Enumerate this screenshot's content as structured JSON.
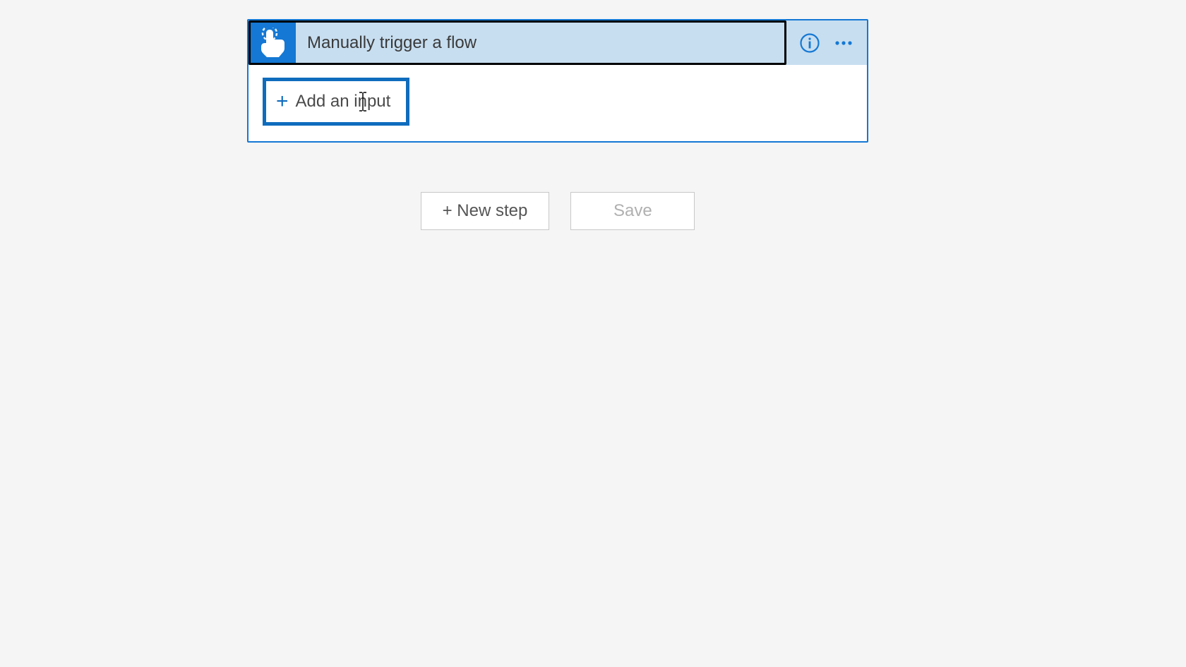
{
  "trigger": {
    "title": "Manually trigger a flow",
    "add_input_label": "Add an input"
  },
  "actions": {
    "new_step_label": "+ New step",
    "save_label": "Save"
  }
}
